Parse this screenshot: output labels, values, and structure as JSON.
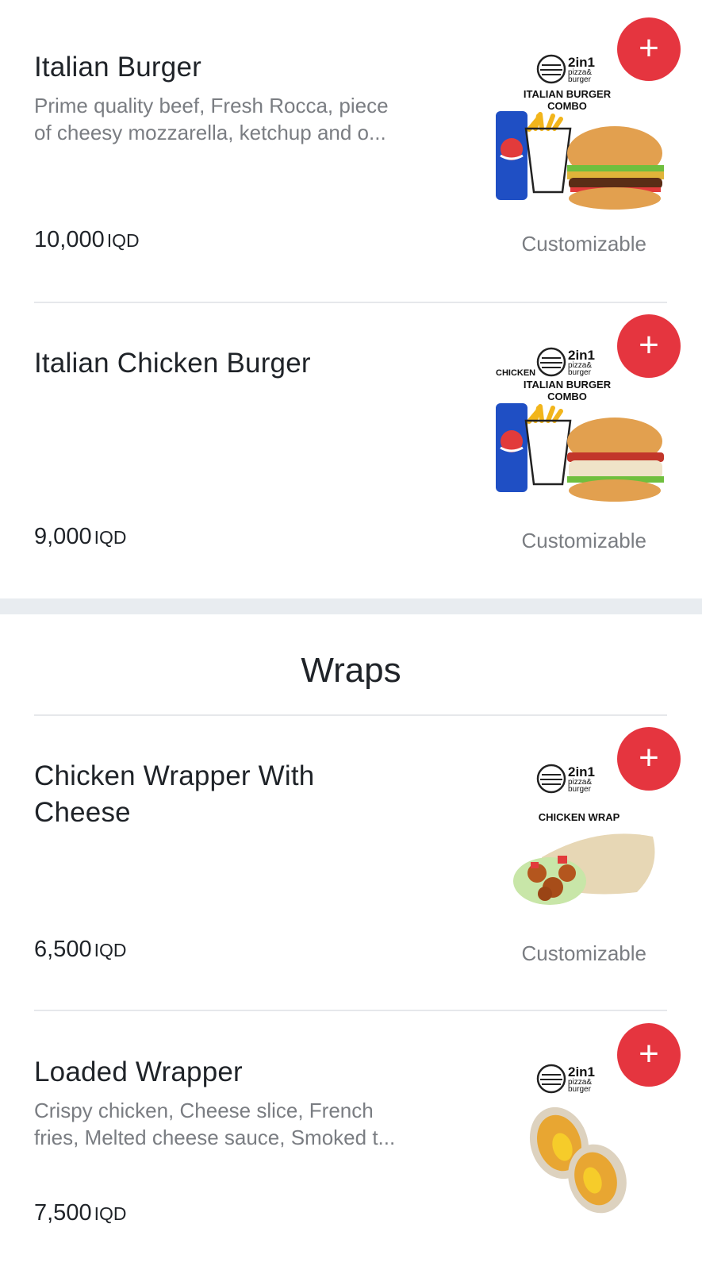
{
  "currency": "IQD",
  "customizable_label": "Customizable",
  "add_symbol": "+",
  "items": [
    {
      "name": "Italian Burger",
      "desc_line1": "Prime quality beef, Fresh Rocca, piece",
      "desc_line2": "of cheesy mozzarella, ketchup and o...",
      "price": "10,000",
      "customizable": true,
      "image_brand": "2in1",
      "image_sub1": "pizza&",
      "image_sub2": "burger",
      "image_caption1": "ITALIAN BURGER",
      "image_caption2": "COMBO"
    },
    {
      "name": "Italian Chicken Burger",
      "price": "9,000",
      "customizable": true,
      "image_brand": "2in1",
      "image_sub1": "pizza&",
      "image_sub2": "burger",
      "image_prefix": "CHICKEN",
      "image_caption1": "ITALIAN BURGER",
      "image_caption2": "COMBO"
    }
  ],
  "section": {
    "title": "Wraps"
  },
  "wraps": [
    {
      "name": "Chicken Wrapper With Cheese",
      "price": "6,500",
      "customizable": true,
      "image_brand": "2in1",
      "image_sub1": "pizza&",
      "image_sub2": "burger",
      "image_caption1": "CHICKEN WRAP"
    },
    {
      "name": "Loaded Wrapper",
      "desc_line1": "Crispy chicken, Cheese slice, French",
      "desc_line2": "fries, Melted cheese sauce, Smoked t...",
      "price": "7,500",
      "image_brand": "2in1",
      "image_sub1": "pizza&",
      "image_sub2": "burger"
    }
  ],
  "colors": {
    "accent": "#e5353f",
    "text": "#1f2328",
    "muted": "#7a7d82",
    "divider": "#e6e8eb",
    "section_band": "#e8ecf0"
  }
}
